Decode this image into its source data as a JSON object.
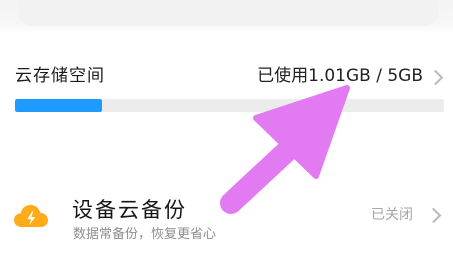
{
  "storage": {
    "title": "云存储空间",
    "usage_text": "已使用1.01GB / 5GB",
    "used_fraction": 0.202
  },
  "backup": {
    "title": "设备云备份",
    "subtitle": "数据常备份，恢复更省心",
    "status": "已关闭"
  },
  "colors": {
    "progress_fill": "#1e9bff",
    "progress_track": "#ececec",
    "cloud_icon": "#ffab1a",
    "annotation_arrow": "#e27af2"
  },
  "icons": {
    "storage_chevron": "chevron-right-icon",
    "backup_icon": "cloud-lightning-icon",
    "backup_chevron": "chevron-right-icon"
  }
}
